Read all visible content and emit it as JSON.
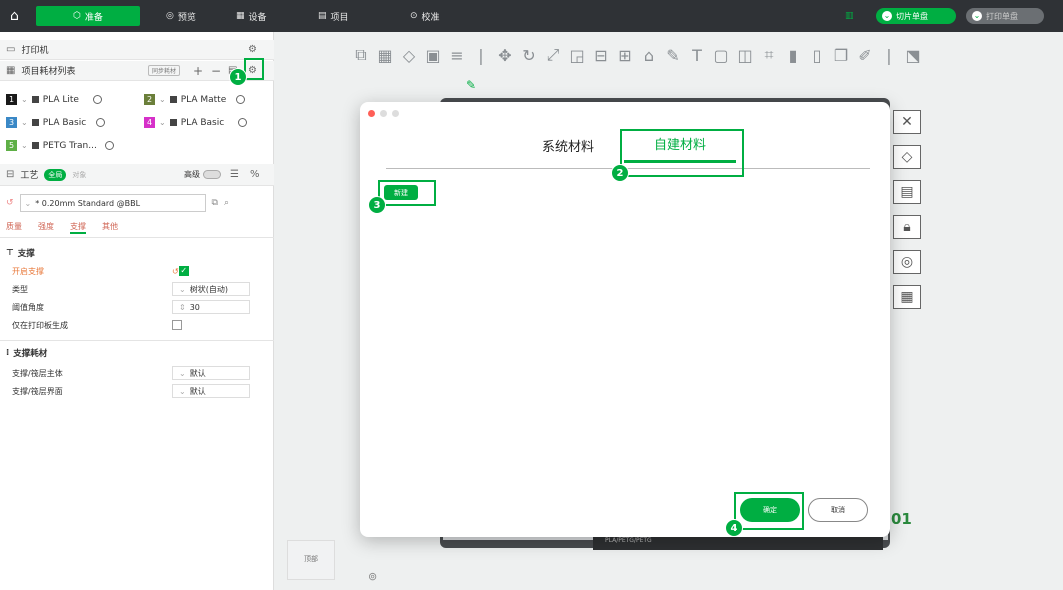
{
  "topbar": {
    "tabs": [
      {
        "label": "准备",
        "icon": "cube-icon"
      },
      {
        "label": "预览",
        "icon": "eye-icon"
      },
      {
        "label": "设备",
        "icon": "device-icon"
      },
      {
        "label": "项目",
        "icon": "project-icon"
      },
      {
        "label": "校准",
        "icon": "calibrate-icon"
      }
    ],
    "slice_label": "切片单盘",
    "print_label": "打印单盘"
  },
  "left_panel": {
    "printer_header": "打印机",
    "filament_header": "项目耗材列表",
    "filament_badge": "同步耗材",
    "filaments": [
      {
        "num": "1",
        "name": "PLA Lite",
        "color": "#1a1a1a"
      },
      {
        "num": "2",
        "name": "PLA Matte",
        "color": "#6b7f3a"
      },
      {
        "num": "3",
        "name": "PLA Basic",
        "color": "#3a88c6"
      },
      {
        "num": "4",
        "name": "PLA Basic",
        "color": "#d630c9"
      },
      {
        "num": "5",
        "name": "PETG Tran...",
        "color": "#5eaf46"
      }
    ],
    "process_header": "工艺",
    "process_badge": "全局",
    "process_badge2": "对象",
    "advanced_label": "高级",
    "profile_name": "* 0.20mm Standard @BBL",
    "tabs": [
      "质量",
      "强度",
      "支撑",
      "其他"
    ],
    "support_group": "支撑",
    "params": [
      {
        "label": "开启支撑",
        "value": ""
      },
      {
        "label": "类型",
        "value": "树状(自动)"
      },
      {
        "label": "阈值角度",
        "value": "30"
      },
      {
        "label": "仅在打印板生成",
        "value": ""
      }
    ],
    "support_filament_group": "支撑耗材",
    "filament_params": [
      {
        "label": "支撑/筏层主体",
        "value": "默认"
      },
      {
        "label": "支撑/筏层界面",
        "value": "默认"
      }
    ]
  },
  "dialog": {
    "tab_system": "系统材料",
    "tab_custom": "自建材料",
    "new_button": "新建",
    "ok_button": "确定",
    "cancel_button": "取消"
  },
  "callouts": [
    "1",
    "2",
    "3",
    "4"
  ],
  "canvas": {
    "plate_number": "01",
    "bottom_box_label": "顶部",
    "plate_strip_text": "PLA/PETG/PETG"
  },
  "colors": {
    "accent": "#00ae42",
    "topbar": "#2f3236"
  }
}
